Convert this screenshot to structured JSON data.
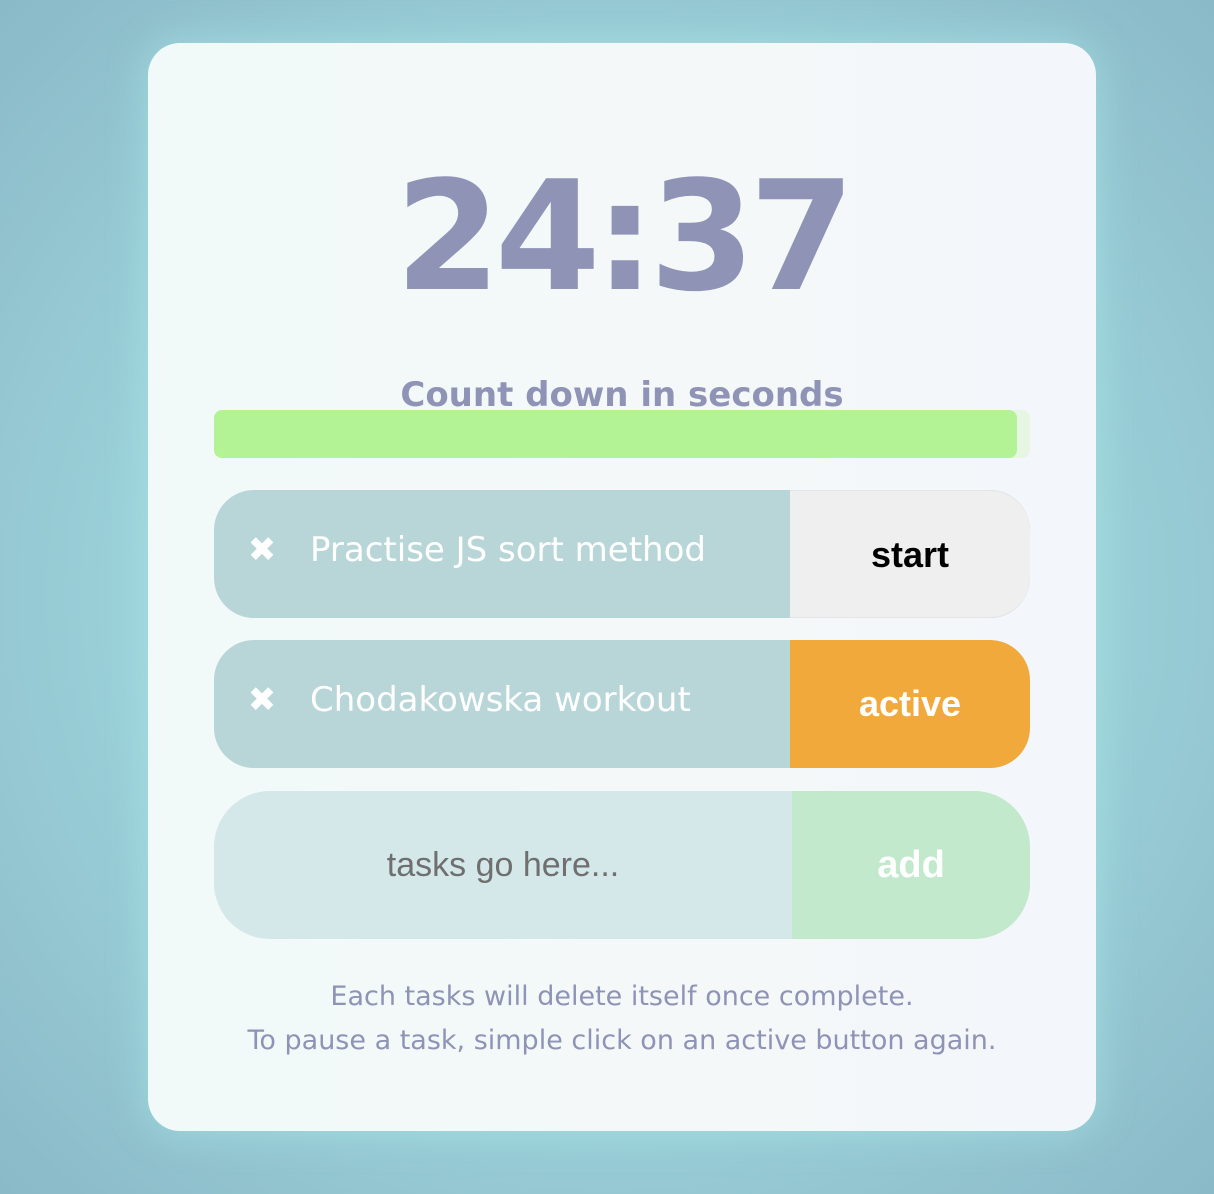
{
  "timer": {
    "display": "24:37",
    "caption": "Count down in seconds"
  },
  "progress": {
    "fraction": 0.984,
    "color": "#b3f395"
  },
  "tasks": [
    {
      "remove_icon": "close-icon",
      "remove_glyph": "✖",
      "title": "Practise JS sort method",
      "button_label": "start",
      "state": "idle"
    },
    {
      "remove_icon": "close-icon",
      "remove_glyph": "✖",
      "title": "Chodakowska workout",
      "button_label": "active",
      "state": "active"
    }
  ],
  "new_task": {
    "placeholder": "tasks go here...",
    "value": "",
    "add_label": "add"
  },
  "footnote": {
    "line1": "Each tasks will delete itself once complete.",
    "line2": "To pause a task, simple click on an active button again."
  },
  "colors": {
    "accent_text": "#8f93b5",
    "active": "#f2a93c",
    "task_bg": "#b8d6d7",
    "add_bg": "#c2e9cb"
  }
}
